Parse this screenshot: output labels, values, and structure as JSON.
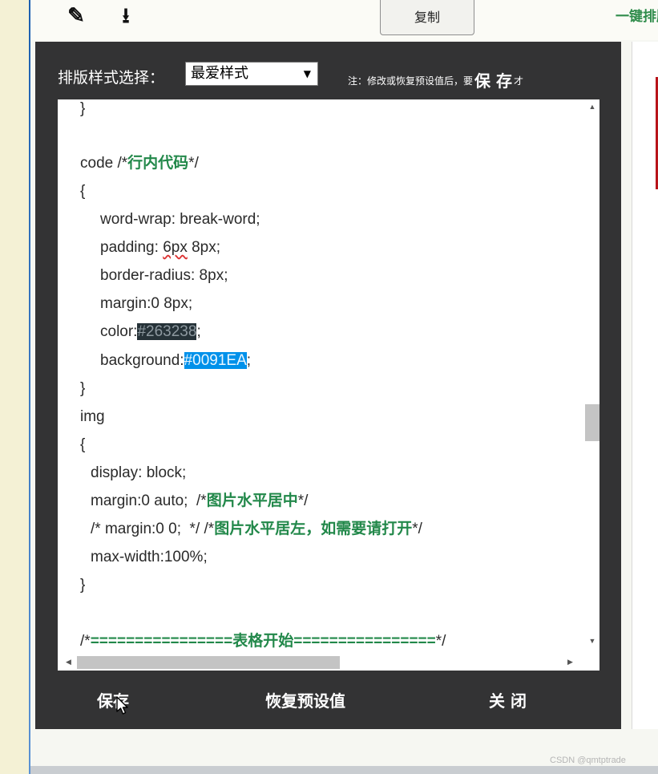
{
  "toolbar": {
    "copy_label": "复制",
    "right_text": "一键排版",
    "edit_icon_glyph": "✎",
    "download_icon_glyph": "⭳"
  },
  "dialog": {
    "style_label": "排版样式选择：",
    "style_selected": "最爱样式",
    "note_prefix": "注：修改或恢复预设值后，要",
    "note_emph": "保 存",
    "note_suffix": "才",
    "code": {
      "l0": "}",
      "l1": "code /*",
      "l1c": "行内代码",
      "l1e": "*/",
      "l2": "{",
      "l3": "word-wrap: break-word;",
      "l4a": "padding: ",
      "l4b": "6px",
      "l4c": " 8px;",
      "l5": "border-radius: 8px;",
      "l6": "margin:0 8px;",
      "l7a": "color:",
      "l7b": "#263238",
      "l7c": ";",
      "l8a": "background:",
      "l8b": "#0091EA",
      "l8c": ";",
      "l9": "}",
      "l10": "img",
      "l11": "{",
      "l12": "display: block;",
      "l13a": "margin:0 auto;  /*",
      "l13b": "图片水平居中",
      "l13c": "*/",
      "l14a": "/* margin:0 0;  */ /*",
      "l14b": "图片水平居左，如需要请打开",
      "l14c": "*/",
      "l15": "max-width:100%;",
      "l16": "}",
      "l17a": "/*",
      "l17b": "================表格开始================",
      "l17c": "*/"
    },
    "footer": {
      "save": "保存",
      "restore": "恢复预设值",
      "close": "关 闭"
    }
  },
  "watermark": "CSDN @qmtptrade",
  "colors": {
    "dialog_bg": "#333334",
    "comment_green": "#22884a",
    "hl_dark": "#263238",
    "hl_blue": "#0091EA",
    "accent_red": "#b8141a"
  }
}
